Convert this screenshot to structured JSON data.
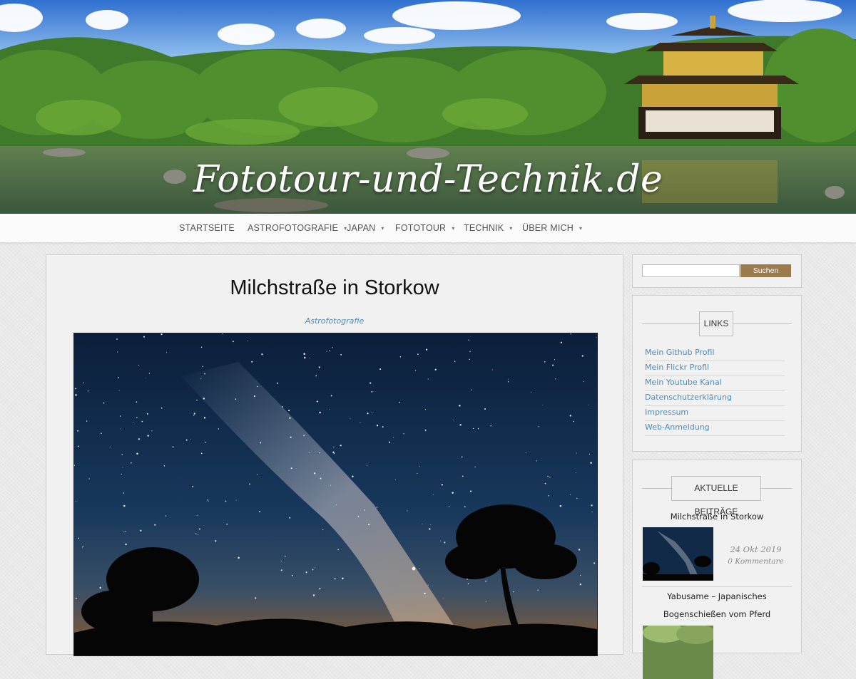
{
  "site": {
    "title": "Fototour-und-Technik.de"
  },
  "nav": {
    "items": [
      {
        "label": "STARTSEITE",
        "has_submenu": false
      },
      {
        "label": "ASTROFOTOGRAFIE",
        "has_submenu": true
      },
      {
        "label": "JAPAN",
        "has_submenu": true
      },
      {
        "label": "FOTOTOUR",
        "has_submenu": true
      },
      {
        "label": "TECHNIK",
        "has_submenu": true
      },
      {
        "label": "ÜBER MICH",
        "has_submenu": true
      }
    ],
    "caret": "▾"
  },
  "post": {
    "title": "Milchstraße in Storkow",
    "category": "Astrofotografie"
  },
  "sidebar": {
    "search": {
      "value": "",
      "button_label": "Suchen"
    },
    "links": {
      "heading": "LINKS",
      "items": [
        "Mein Github Profil",
        "Mein Flickr Profil",
        "Mein Youtube Kanal",
        "Datenschutzerklärung",
        "Impressum",
        "Web-Anmeldung"
      ]
    },
    "recent": {
      "heading": "AKTUELLE BEITRÄGE",
      "posts": [
        {
          "title": "Milchstraße in Storkow",
          "date": "24 Okt 2019",
          "comments": "0 Kommentare"
        },
        {
          "title_line1": "Yabusame – Japanisches",
          "title_line2": "Bogenschießen vom Pferd"
        }
      ]
    }
  },
  "colors": {
    "accent_link": "#4f8ab5",
    "search_button": "#9a7b4e"
  }
}
